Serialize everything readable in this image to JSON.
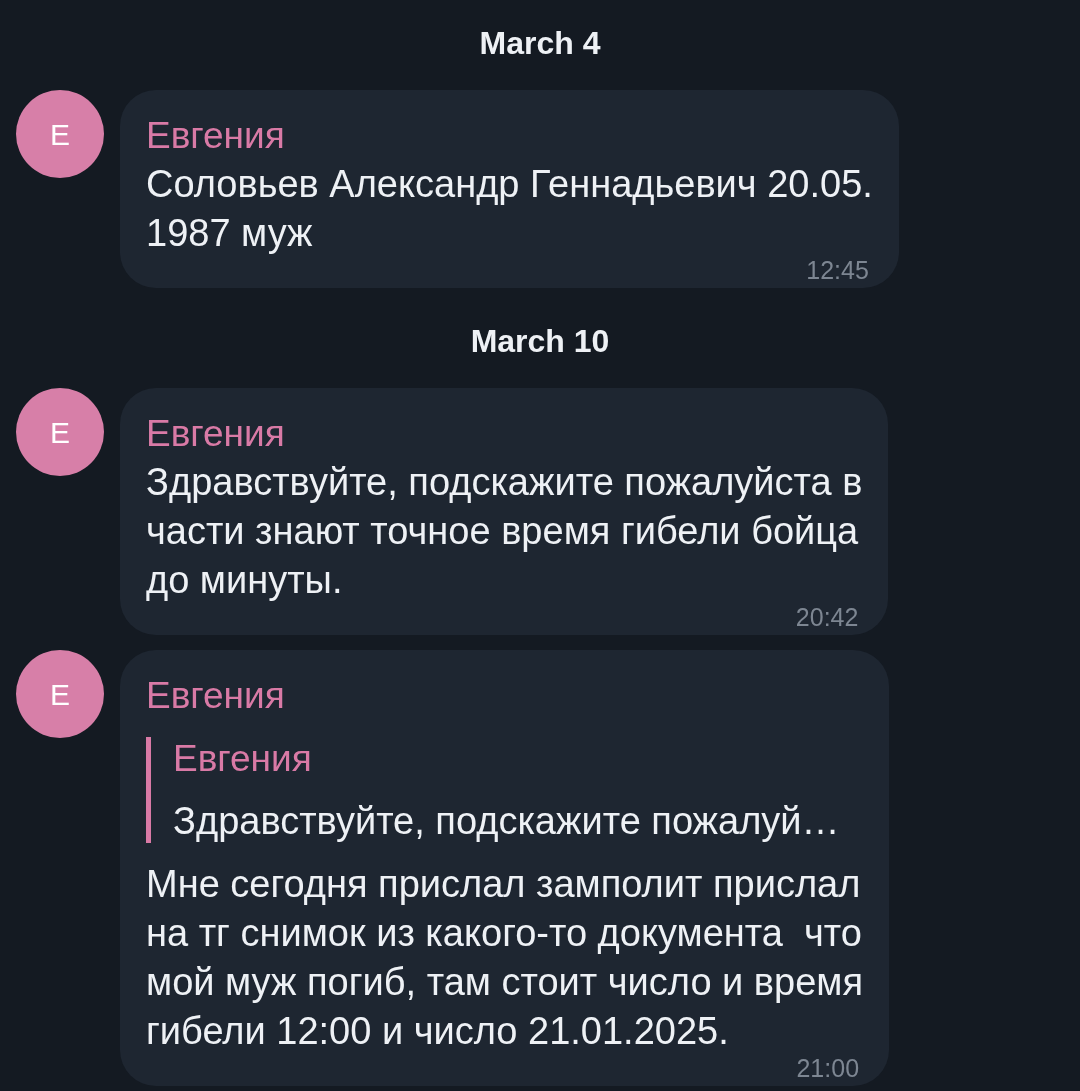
{
  "feed": [
    {
      "kind": "date",
      "text": "March 4"
    },
    {
      "kind": "message",
      "avatar": "E",
      "sender": "Евгения",
      "text": "Соловьев Александр Геннадьевич 20.05.\n1987 муж",
      "time": "12:45"
    },
    {
      "kind": "date",
      "text": "March 10"
    },
    {
      "kind": "message",
      "avatar": "E",
      "sender": "Евгения",
      "text": "Здравствуйте, подскажите пожалуйста в\nчасти знают точное время гибели бойца\nдо минуты.",
      "time": "20:42"
    },
    {
      "kind": "message",
      "avatar": "E",
      "sender": "Евгения",
      "reply": {
        "sender": "Евгения",
        "text": "Здравствуйте, подскажите пожалуй…"
      },
      "text": "Мне сегодня прислал замполит прислал\nна тг снимок из какого-то документа  что\nмой муж погиб, там стоит число и время\nгибели 12:00 и число 21.01.2025.",
      "time": "21:00"
    }
  ]
}
